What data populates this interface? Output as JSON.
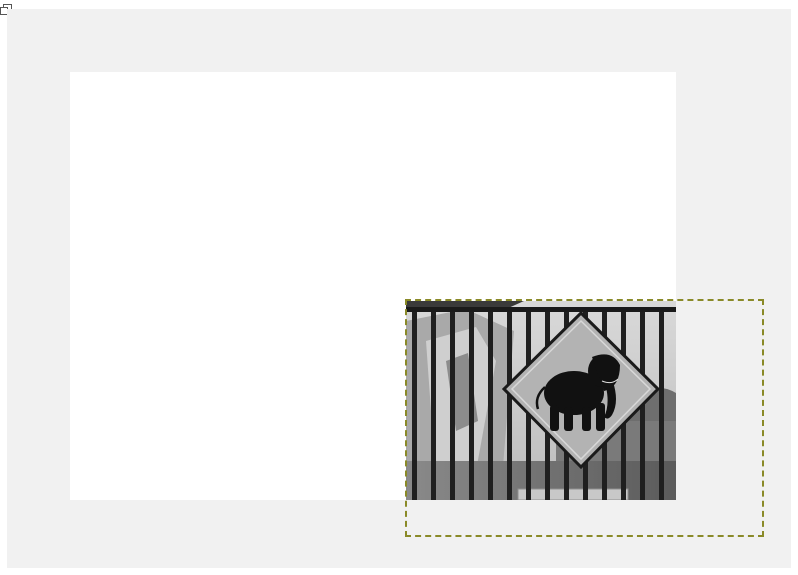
{
  "window": {
    "corner_icon": "window-restore-icon"
  },
  "canvas": {
    "background_color": "#f1f1f1",
    "image_background_color": "#ffffff"
  },
  "layer": {
    "content": "elephant-crossing-sign-photo",
    "sign_icon": "elephant-icon",
    "boundary_color": "#8a8a28"
  }
}
